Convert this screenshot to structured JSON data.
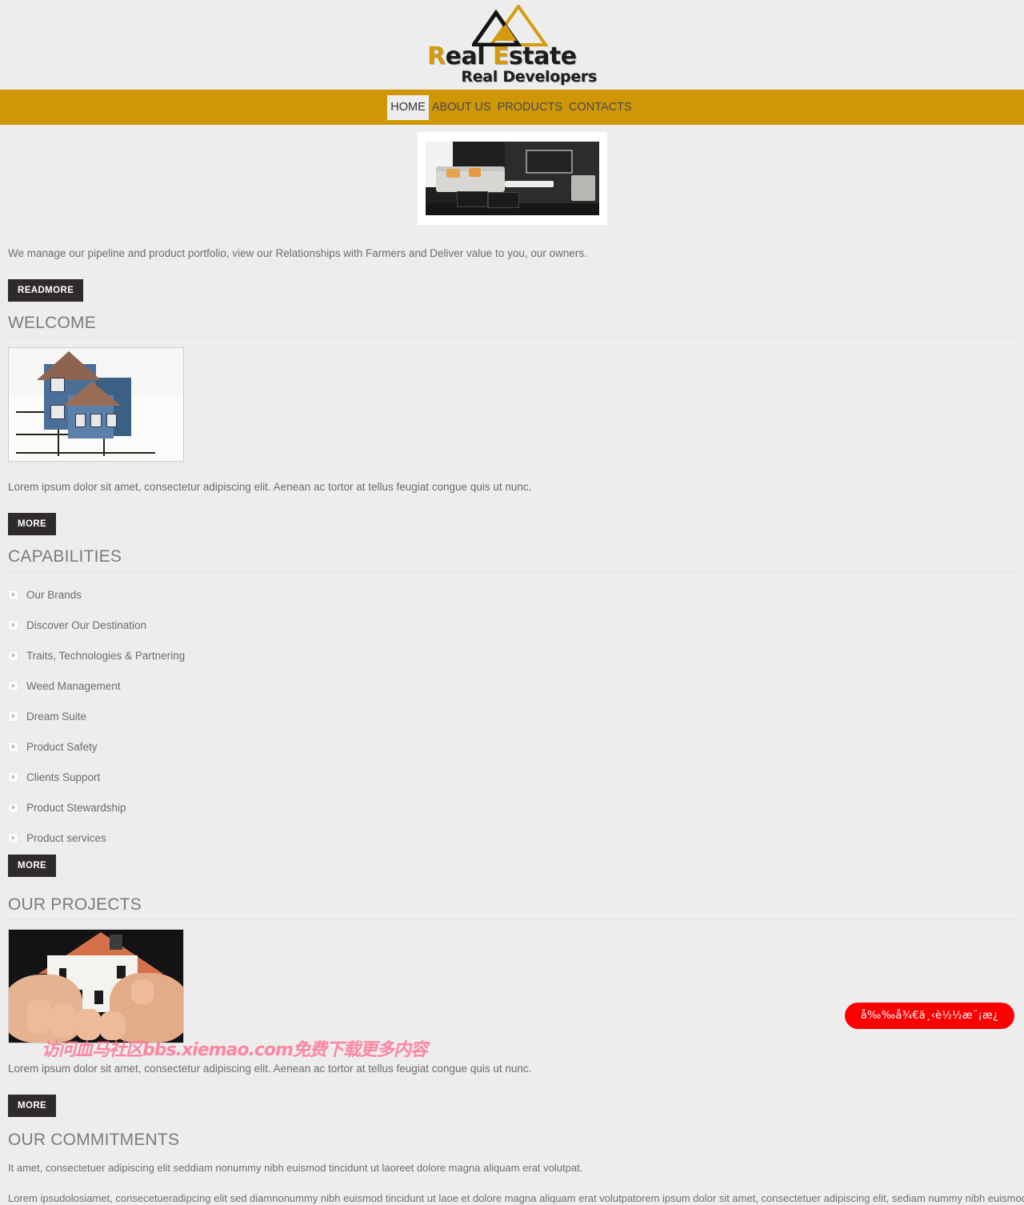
{
  "site": {
    "logo": {
      "mark_icon": "triangle-logo-icon",
      "title_first_letter": "R",
      "title_rest_one": "eal ",
      "title_second_letter": "E",
      "title_rest_two": "state",
      "title_full": "Real Estate",
      "subtitle": "Real Developers"
    }
  },
  "nav": {
    "items": [
      {
        "label": "HOME",
        "active": true
      },
      {
        "label": "ABOUT US",
        "active": false
      },
      {
        "label": "PRODUCTS",
        "active": false
      },
      {
        "label": "CONTACTS",
        "active": false
      }
    ]
  },
  "hero": {
    "image_alt": "modern-living-room-interior",
    "intro_text": "We manage our pipeline and product portfolio, view our Relationships with Farmers and Deliver value to you, our owners.",
    "readmore_label": "READMORE"
  },
  "welcome": {
    "title": "WELCOME",
    "image_alt": "blue-house-model-on-blueprints",
    "text": "Lorem ipsum dolor sit amet, consectetur adipiscing elit. Aenean ac tortor at tellus feugiat congue quis ut nunc.",
    "more_label": "MORE"
  },
  "capabilities": {
    "title": "CAPABILITIES",
    "bullet_icon": "caret-right-icon",
    "items": [
      {
        "label": "Our Brands"
      },
      {
        "label": "Discover Our Destination"
      },
      {
        "label": "Traits, Technologies & Partnering"
      },
      {
        "label": "Weed Management"
      },
      {
        "label": "Dream Suite"
      },
      {
        "label": "Product Safety"
      },
      {
        "label": "Clients Support"
      },
      {
        "label": "Product Stewardship"
      },
      {
        "label": "Product services"
      }
    ],
    "more_label": "MORE"
  },
  "projects": {
    "title": "OUR PROJECTS",
    "image_alt": "hands-holding-house-model",
    "text": "Lorem ipsum dolor sit amet, consectetur adipiscing elit. Aenean ac tortor at tellus feugiat congue quis ut nunc.",
    "more_label": "MORE"
  },
  "commitments": {
    "title": "OUR COMMITMENTS",
    "line_one": "It amet, consectetuer adipiscing elit seddiam nonummy nibh euismod tincidunt ut laoreet dolore magna aliquam erat volutpat.",
    "line_two": "Lorem ipsudolosiamet, consecetueradipcing elit sed diamnonummy nibh euismod tincidunt ut laoe et dolore magna aliquam erat volutpatorem ipsum dolor sit amet, consectetuer adipiscing elit, sediam nummy nibh euismod"
  },
  "overlay": {
    "watermark_text": "访问血马社区bbs.xiemao.com免费下载更多内容",
    "watermark_color": "#ff6b8c",
    "badge_text": "å‰‰å¾€ä¸‹è½½æ¨¡æ¿",
    "badge_color": "#fb0000"
  },
  "colors": {
    "page_bg": "#ededed",
    "nav_bg": "#cf9606",
    "button_bg": "#2f2b2a",
    "heading": "#7b7b7b",
    "body_text": "#6c6c6c",
    "logo_gold": "#d49a10"
  }
}
